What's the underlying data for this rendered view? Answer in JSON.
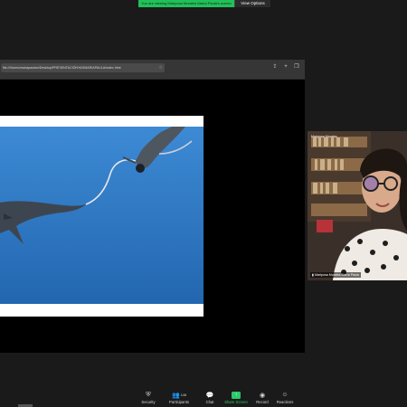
{
  "banner": {
    "message": "You are viewing Mariposa Morales María Paula's screen",
    "view_options": "View Options"
  },
  "browser": {
    "url": "file:///Users/mariapaulam/Desktop/PRESENTACIÓN%20MARIAPAULA/index.html"
  },
  "participant": {
    "top_label": "Mariposa Morales",
    "name_label": "Mariposa Morales María Paula"
  },
  "toolbar": {
    "security": "Security",
    "participants": "Participants",
    "participants_count": "148",
    "chat": "Chat",
    "share_screen": "Share Screen",
    "record": "Record",
    "reactions": "Reactions"
  },
  "colors": {
    "banner_green": "#22c05a",
    "share_green": "#2bc96a",
    "ocean_blue": "#2d78c2"
  }
}
